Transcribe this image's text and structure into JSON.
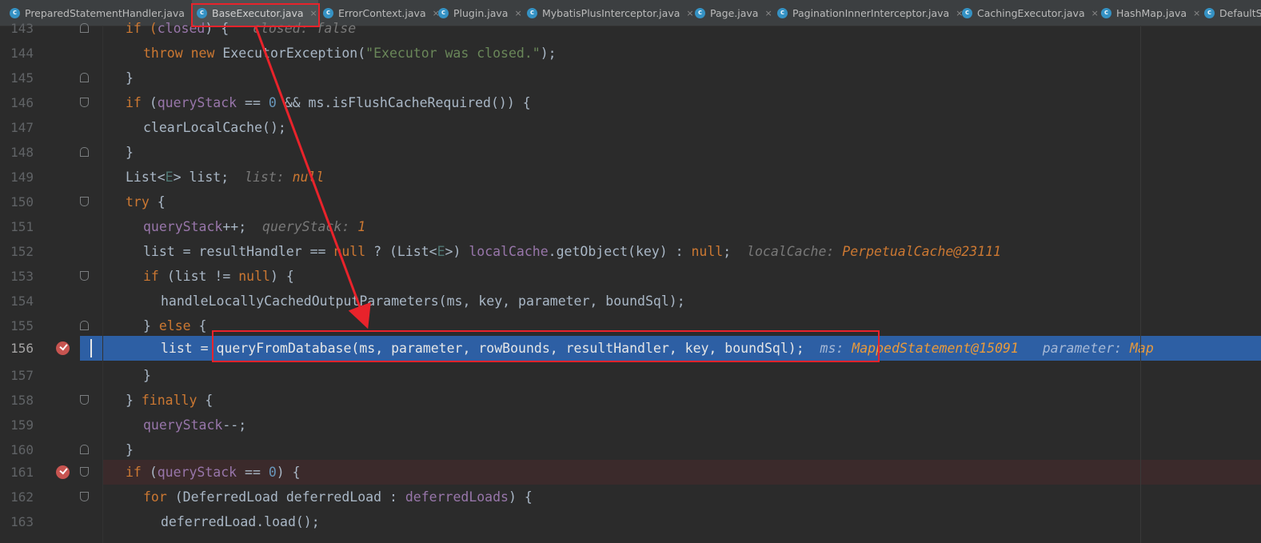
{
  "tabs": [
    {
      "label": "PreparedStatementHandler.java",
      "close": ""
    },
    {
      "label": "BaseExecutor.java",
      "close": "×",
      "active": true
    },
    {
      "label": "ErrorContext.java",
      "close": "×"
    },
    {
      "label": "Plugin.java",
      "close": "×"
    },
    {
      "label": "MybatisPlusInterceptor.java",
      "close": "×"
    },
    {
      "label": "Page.java",
      "close": "×"
    },
    {
      "label": "PaginationInnerInterceptor.java",
      "close": "×"
    },
    {
      "label": "CachingExecutor.java",
      "close": "×"
    },
    {
      "label": "HashMap.java",
      "close": "×"
    },
    {
      "label": "DefaultS",
      "close": ""
    }
  ],
  "tab_icon_letter": "c",
  "lines": {
    "l143": {
      "num": "143",
      "a": "if (",
      "b": "closed",
      "c": ") {   ",
      "h": "closed: ",
      "v": "false"
    },
    "l144": {
      "num": "144",
      "kw1": "throw new ",
      "t1": "ExecutorException(",
      "s1": "\"Executor was closed.\"",
      "t2": ");"
    },
    "l145": {
      "num": "145",
      "t": "}"
    },
    "l146": {
      "num": "146",
      "kw1": "if ",
      "t1": "(",
      "f1": "queryStack",
      "t2": " == ",
      "n1": "0",
      "t3": " && ms.isFlushCacheRequired()) {"
    },
    "l147": {
      "num": "147",
      "t": "clearLocalCache();"
    },
    "l148": {
      "num": "148",
      "t": "}"
    },
    "l149": {
      "num": "149",
      "t1": "List<",
      "g1": "E",
      "t2": "> list;  ",
      "h": "list: ",
      "v": "null"
    },
    "l150": {
      "num": "150",
      "kw1": "try ",
      "t1": "{"
    },
    "l151": {
      "num": "151",
      "f1": "queryStack",
      "t1": "++;  ",
      "h": "queryStack: ",
      "v": "1"
    },
    "l152": {
      "num": "152",
      "t1": "list = resultHandler == ",
      "kw1": "null ",
      "t2": "? (List<",
      "g1": "E",
      "t3": ">) ",
      "f1": "localCache",
      "t4": ".getObject(key) : ",
      "kw2": "null",
      "t5": ";  ",
      "h": "localCache: ",
      "v": "PerpetualCache@23111"
    },
    "l153": {
      "num": "153",
      "kw1": "if ",
      "t1": "(list != ",
      "kw2": "null",
      "t2": ") {"
    },
    "l154": {
      "num": "154",
      "t1": "handleLocallyCachedOutputParameters(ms, key, parameter, boundSql);"
    },
    "l155": {
      "num": "155",
      "t1": "} ",
      "kw1": "else ",
      "t2": "{"
    },
    "l156": {
      "num": "156",
      "t1": "list = queryFromDatabase(ms, parameter, rowBounds, resultHandler, key, boundSql);",
      "h1": "ms: ",
      "v1": "MappedStatement@15091",
      "h2": "parameter: ",
      "v2": "Map"
    },
    "l157": {
      "num": "157",
      "t": "}"
    },
    "l158": {
      "num": "158",
      "t1": "} ",
      "kw1": "finally ",
      "t2": "{"
    },
    "l159": {
      "num": "159",
      "f1": "queryStack",
      "t1": "--;"
    },
    "l160": {
      "num": "160",
      "t": "}"
    },
    "l161": {
      "num": "161",
      "kw1": "if ",
      "t1": "(",
      "f1": "queryStack",
      "t2": " == ",
      "n1": "0",
      "t3": ") {"
    },
    "l162": {
      "num": "162",
      "kw1": "for ",
      "t1": "(DeferredLoad deferredLoad : ",
      "f1": "deferredLoads",
      "t2": ") {"
    },
    "l163": {
      "num": "163",
      "t": "deferredLoad.load();"
    }
  },
  "colors": {
    "annotation": "#e8232b",
    "execution_line": "#2d5fa4",
    "breakpoint": "#c75450"
  }
}
